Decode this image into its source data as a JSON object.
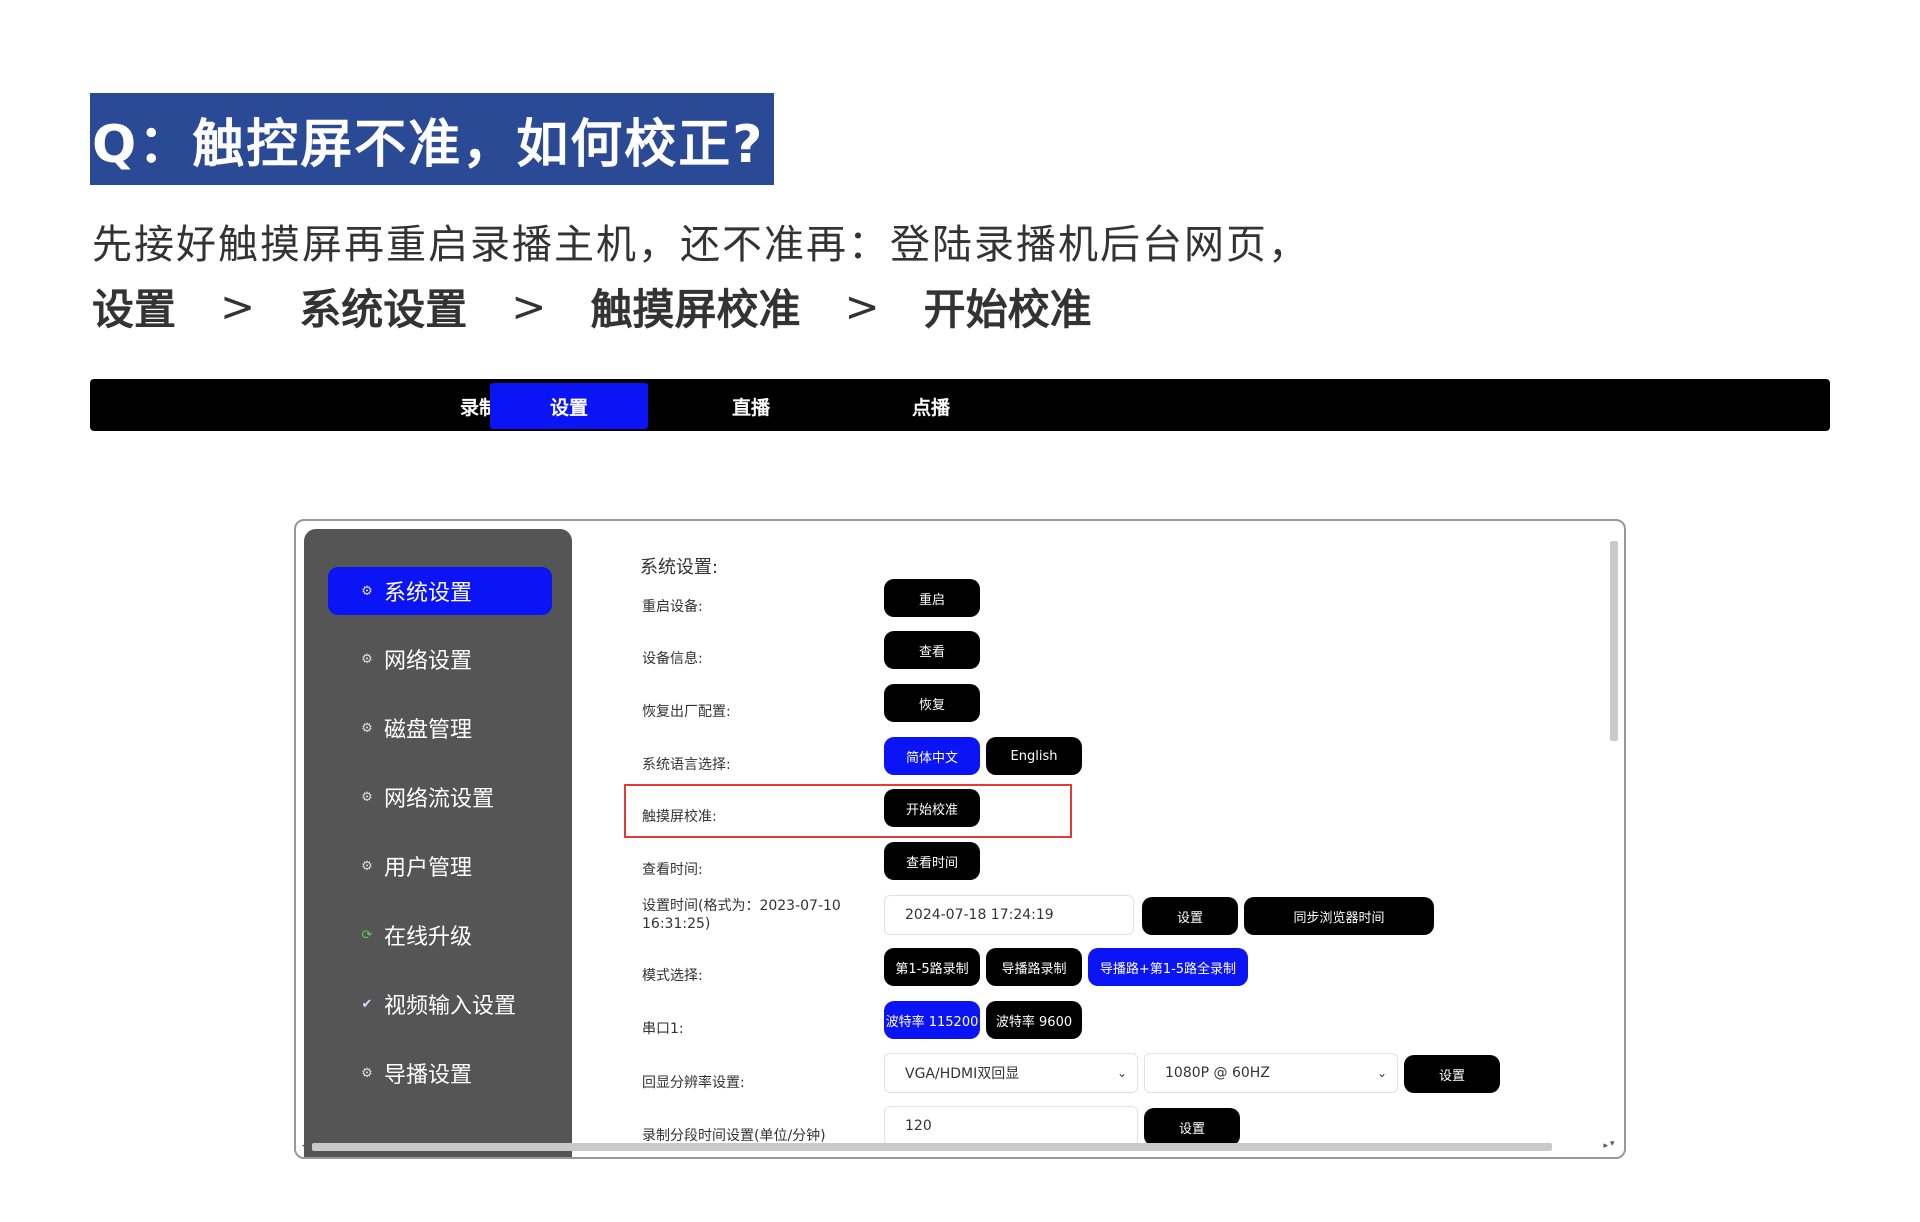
{
  "question": {
    "title": "Q：触控屏不准，如何校正?"
  },
  "instruction": {
    "text": "先接好触摸屏再重启录播主机，还不准再：登陆录播机后台网页，",
    "breadcrumb": [
      "设置",
      "系统设置",
      "触摸屏校准",
      "开始校准"
    ],
    "separator": ">"
  },
  "top_nav": {
    "tabs": [
      {
        "label": "录制",
        "active": false
      },
      {
        "label": "设置",
        "active": true
      },
      {
        "label": "直播",
        "active": false
      },
      {
        "label": "点播",
        "active": false
      }
    ],
    "active_color": "#0a14f5"
  },
  "sidebar": {
    "items": [
      {
        "label": "系统设置",
        "icon": "gear-icon",
        "active": true
      },
      {
        "label": "网络设置",
        "icon": "gear-icon",
        "active": false
      },
      {
        "label": "磁盘管理",
        "icon": "gear-icon",
        "active": false
      },
      {
        "label": "网络流设置",
        "icon": "gear-icon",
        "active": false
      },
      {
        "label": "用户管理",
        "icon": "gear-icon",
        "active": false
      },
      {
        "label": "在线升级",
        "icon": "refresh-icon",
        "active": false
      },
      {
        "label": "视频输入设置",
        "icon": "check-circle-icon",
        "active": false
      },
      {
        "label": "导播设置",
        "icon": "gear-icon",
        "active": false
      }
    ]
  },
  "settings": {
    "section_title": "系统设置:",
    "reboot": {
      "label": "重启设备:",
      "button": "重启"
    },
    "device_info": {
      "label": "设备信息:",
      "button": "查看"
    },
    "factory_reset": {
      "label": "恢复出厂配置:",
      "button": "恢复"
    },
    "language": {
      "label": "系统语言选择:",
      "options": [
        "简体中文",
        "English"
      ],
      "selected": "简体中文"
    },
    "touch_calibration": {
      "label": "触摸屏校准:",
      "button": "开始校准"
    },
    "view_time": {
      "label": "查看时间:",
      "button": "查看时间"
    },
    "set_time": {
      "label_line1": "设置时间(格式为：2023-07-10",
      "label_line2": "16:31:25)",
      "value": "2024-07-18 17:24:19",
      "set_button": "设置",
      "sync_button": "同步浏览器时间"
    },
    "mode": {
      "label": "模式选择:",
      "options": [
        "第1-5路录制",
        "导播路录制",
        "导播路+第1-5路全录制"
      ],
      "selected": "导播路+第1-5路全录制"
    },
    "serial": {
      "label": "串口1:",
      "options": [
        "波特率 115200",
        "波特率 9600"
      ],
      "selected": "波特率 115200"
    },
    "display_res": {
      "label": "回显分辨率设置:",
      "mode_value": "VGA/HDMI双回显",
      "res_value": "1080P @ 60HZ",
      "button": "设置"
    },
    "segment_time": {
      "label": "录制分段时间设置(单位/分钟)",
      "value": "120",
      "button": "设置"
    }
  },
  "highlight_color": "#e53935"
}
